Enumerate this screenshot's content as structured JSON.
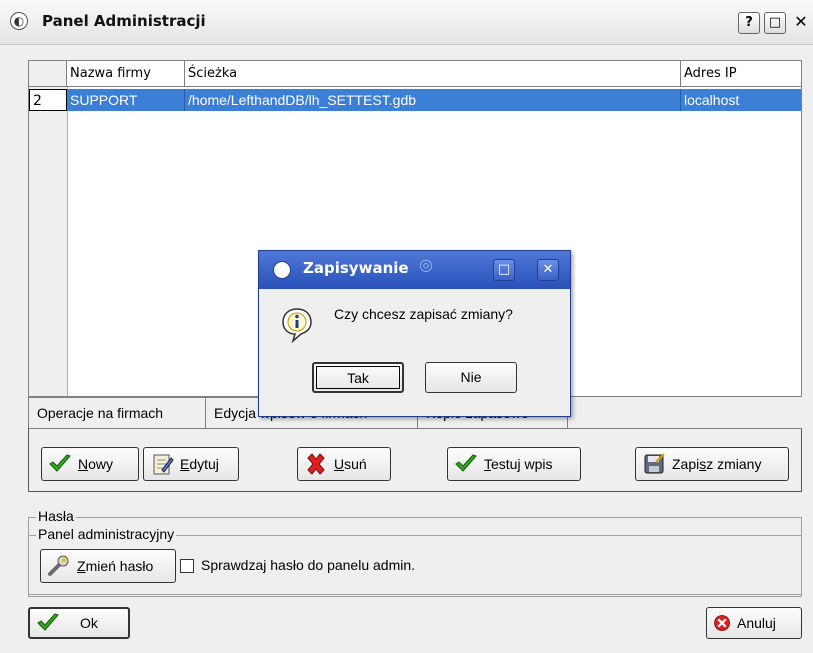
{
  "window": {
    "title": "Panel Administracji",
    "help_label": "?",
    "max_label": "□",
    "close_label": "✕"
  },
  "table": {
    "columns": [
      "Nazwa firmy",
      "Ścieżka",
      "Adres IP"
    ],
    "rows": [
      {
        "num": "2",
        "name": "SUPPORT",
        "path": "/home/LefthandDB/lh_SETTEST.gdb",
        "ip": "localhost"
      }
    ],
    "selected_color": "#3c7fd6"
  },
  "tabs": [
    {
      "label": "Operacje na firmach"
    },
    {
      "label": "Edycja wpisów o firmach"
    },
    {
      "label": "Kopie zapasowe"
    }
  ],
  "actions": {
    "new": {
      "pre": "",
      "u": "N",
      "post": "owy"
    },
    "edit": {
      "pre": "",
      "u": "E",
      "post": "dytuj"
    },
    "delete": {
      "pre": "",
      "u": "U",
      "post": "suń"
    },
    "test": {
      "pre": "",
      "u": "T",
      "post": "estuj wpis"
    },
    "save": {
      "pre": "Zapi",
      "u": "s",
      "post": "z zmiany"
    }
  },
  "passwords": {
    "group_label": "Hasła",
    "subgroup_label": "Panel administracyjny",
    "change_pre": "",
    "change_u": "Z",
    "change_post": "mień hasło",
    "checkbox_label": "Sprawdzaj hasło do panelu admin.",
    "checkbox_checked": false
  },
  "footer": {
    "ok_label": "Ok",
    "cancel_label": "Anuluj"
  },
  "dialog": {
    "title": "Zapisywanie",
    "message": "Czy chcesz zapisać zmiany?",
    "yes_label": "Tak",
    "no_label": "Nie",
    "max_label": "□",
    "close_label": "✕",
    "titlebar_color": "#2951b8"
  }
}
